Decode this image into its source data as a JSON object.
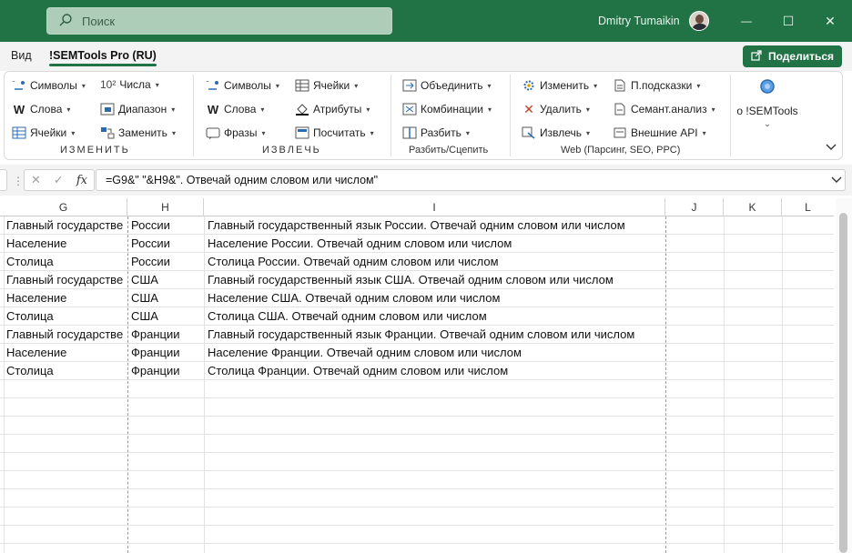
{
  "titlebar": {
    "search_placeholder": "Поиск",
    "user_name": "Dmitry Tumaikin",
    "minimize": "—",
    "maximize": "☐",
    "close": "✕"
  },
  "menu": {
    "tabs": [
      "Вид",
      "!SEMTools Pro (RU)"
    ],
    "share_label": "Поделиться"
  },
  "ribbon": {
    "group1": {
      "label": "ИЗМЕНИТЬ",
      "buttons": [
        "Символы",
        "Числа",
        "Слова",
        "Диапазон",
        "Ячейки",
        "Заменить"
      ],
      "numbers_icon": "10²"
    },
    "group2": {
      "label": "ИЗВЛЕЧЬ",
      "buttons": [
        "Символы",
        "Ячейки",
        "Слова",
        "Атрибуты",
        "Фразы",
        "Посчитать"
      ]
    },
    "group3": {
      "label": "Разбить/Сцепить",
      "buttons": [
        "Объединить",
        "Комбинации",
        "Разбить"
      ]
    },
    "group4": {
      "label": "Web (Парсинг, SEO, PPC)",
      "buttons": [
        "Изменить",
        "П.подсказки",
        "Удалить",
        "Семант.анализ",
        "Извлечь",
        "Внешние API"
      ]
    },
    "about_label": "о !SEMTools",
    "collapse_icon": "chevron-down-icon"
  },
  "formula": {
    "fx_label": "fx",
    "value": "=G9&\" \"&H9&\". Отвечай одним словом или числом\""
  },
  "columns": [
    "G",
    "H",
    "I",
    "J",
    "K",
    "L"
  ],
  "rows": [
    [
      "Главный государстве",
      "России",
      "Главный государственный язык России. Отвечай одним словом или числом"
    ],
    [
      "Население",
      "России",
      "Население России. Отвечай одним словом или числом"
    ],
    [
      "Столица",
      "России",
      "Столица России. Отвечай одним словом или числом"
    ],
    [
      "Главный государстве",
      "США",
      "Главный государственный язык США. Отвечай одним словом или числом"
    ],
    [
      "Население",
      "США",
      "Население США. Отвечай одним словом или числом"
    ],
    [
      "Столица",
      "США",
      "Столица США. Отвечай одним словом или числом"
    ],
    [
      "Главный государстве",
      "Франции",
      "Главный государственный язык Франции. Отвечай одним словом или числом"
    ],
    [
      "Население",
      "Франции",
      "Население Франции. Отвечай одним словом или числом"
    ],
    [
      "Столица",
      "Франции",
      "Столица Франции. Отвечай одним словом или числом"
    ]
  ],
  "colors": {
    "accent": "#217346",
    "gridline": "#e2e2e2"
  }
}
